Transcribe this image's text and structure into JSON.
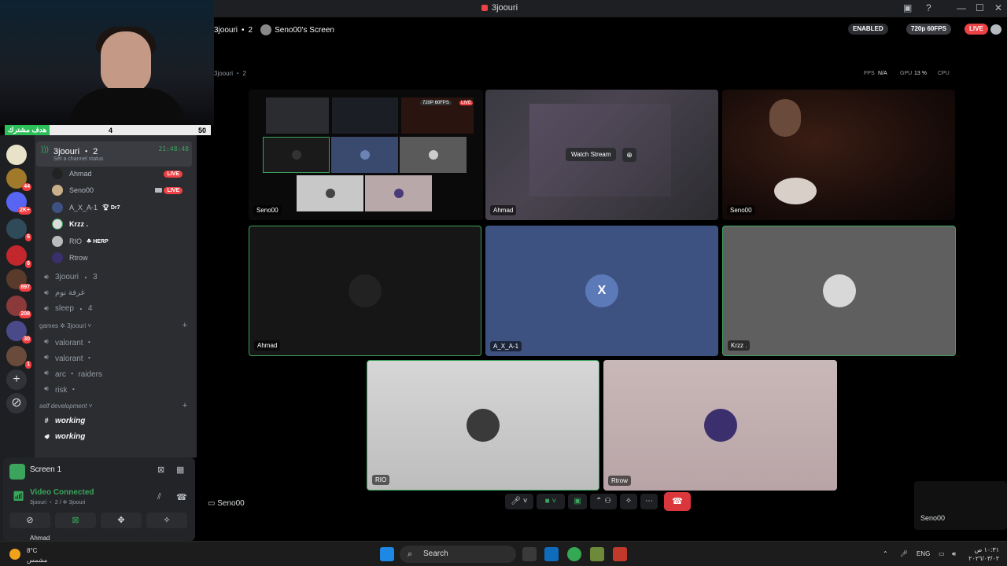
{
  "window": {
    "title": "3joouri"
  },
  "webcam_overlay": {
    "goal_label": "هدف مشترك",
    "goal_current": "4",
    "goal_target": "50"
  },
  "server_rail": {
    "badges": [
      "44",
      "2K+",
      "6",
      "6",
      "897",
      "208",
      "30",
      "1"
    ]
  },
  "channel_list": {
    "active_voice": {
      "name": "3joouri",
      "count": "2",
      "status": "Set a channel status",
      "timer": "21:48:48"
    },
    "members": [
      {
        "name": "Ahmad",
        "live": "LIVE"
      },
      {
        "name": "Seno00",
        "live": "LIVE"
      },
      {
        "name": "A_X_A-1",
        "tag": "Dr7"
      },
      {
        "name": "Krzz ."
      },
      {
        "name": "RIO",
        "tag": "HERP"
      },
      {
        "name": "Rtrow"
      }
    ],
    "voice_channels": [
      {
        "name": "3joouri",
        "count": "3"
      },
      {
        "name": "غرفة نوم"
      },
      {
        "name": "sleep",
        "count": "4"
      }
    ],
    "category_games": "games ✲ 3joouri",
    "games_channels": [
      "valorant ・",
      "valorant ・",
      "arc ・ raiders",
      "risk ・"
    ],
    "category_self": "self development",
    "self_channels": [
      "working",
      "working"
    ]
  },
  "user_panel": {
    "screen_label": "Screen 1",
    "video_connected": "Video Connected",
    "voice_sub": "3joouri ・ 2 / ✲ 3joouri",
    "below_user": "Ahmad"
  },
  "stage": {
    "header_channel": "3joouri",
    "header_count": "2",
    "header_screen": "Seno00's Screen",
    "enabled_pill": "ENABLED",
    "quality_pill": "720p 60FPS",
    "live_pill": "LIVE",
    "stats": {
      "fps_label": "FPS",
      "fps_value": "N/A",
      "gpu_label": "GPU",
      "gpu_value": "13 %",
      "cpu_label": "CPU"
    },
    "inner_header": "3joouri ・ 2",
    "inner_quality": "720P 60FPS",
    "inner_live": "LIVE",
    "watch_stream": "Watch Stream",
    "tiles_top": [
      "Seno00",
      "Ahmad",
      "Seno00"
    ],
    "tiles_mid": [
      "Ahmad",
      "A_X_A-1",
      "Krzz ."
    ],
    "tiles_bottom": [
      "RIO",
      "Rtrow"
    ],
    "axa_initial": "X",
    "footer_user": "Seno00",
    "pip_user": "Seno00"
  },
  "taskbar": {
    "weather_temp": "8°C",
    "weather_desc": "مشمس",
    "search": "Search",
    "lang": "ENG",
    "time": "١٠:٣١ ص",
    "date": "٢٠٢٦/٠٣/٠٢"
  },
  "colors": {
    "accent_green": "#3ba55d",
    "live_red": "#ed4245",
    "sidebar": "#2b2d31",
    "rail": "#1e1f22"
  }
}
